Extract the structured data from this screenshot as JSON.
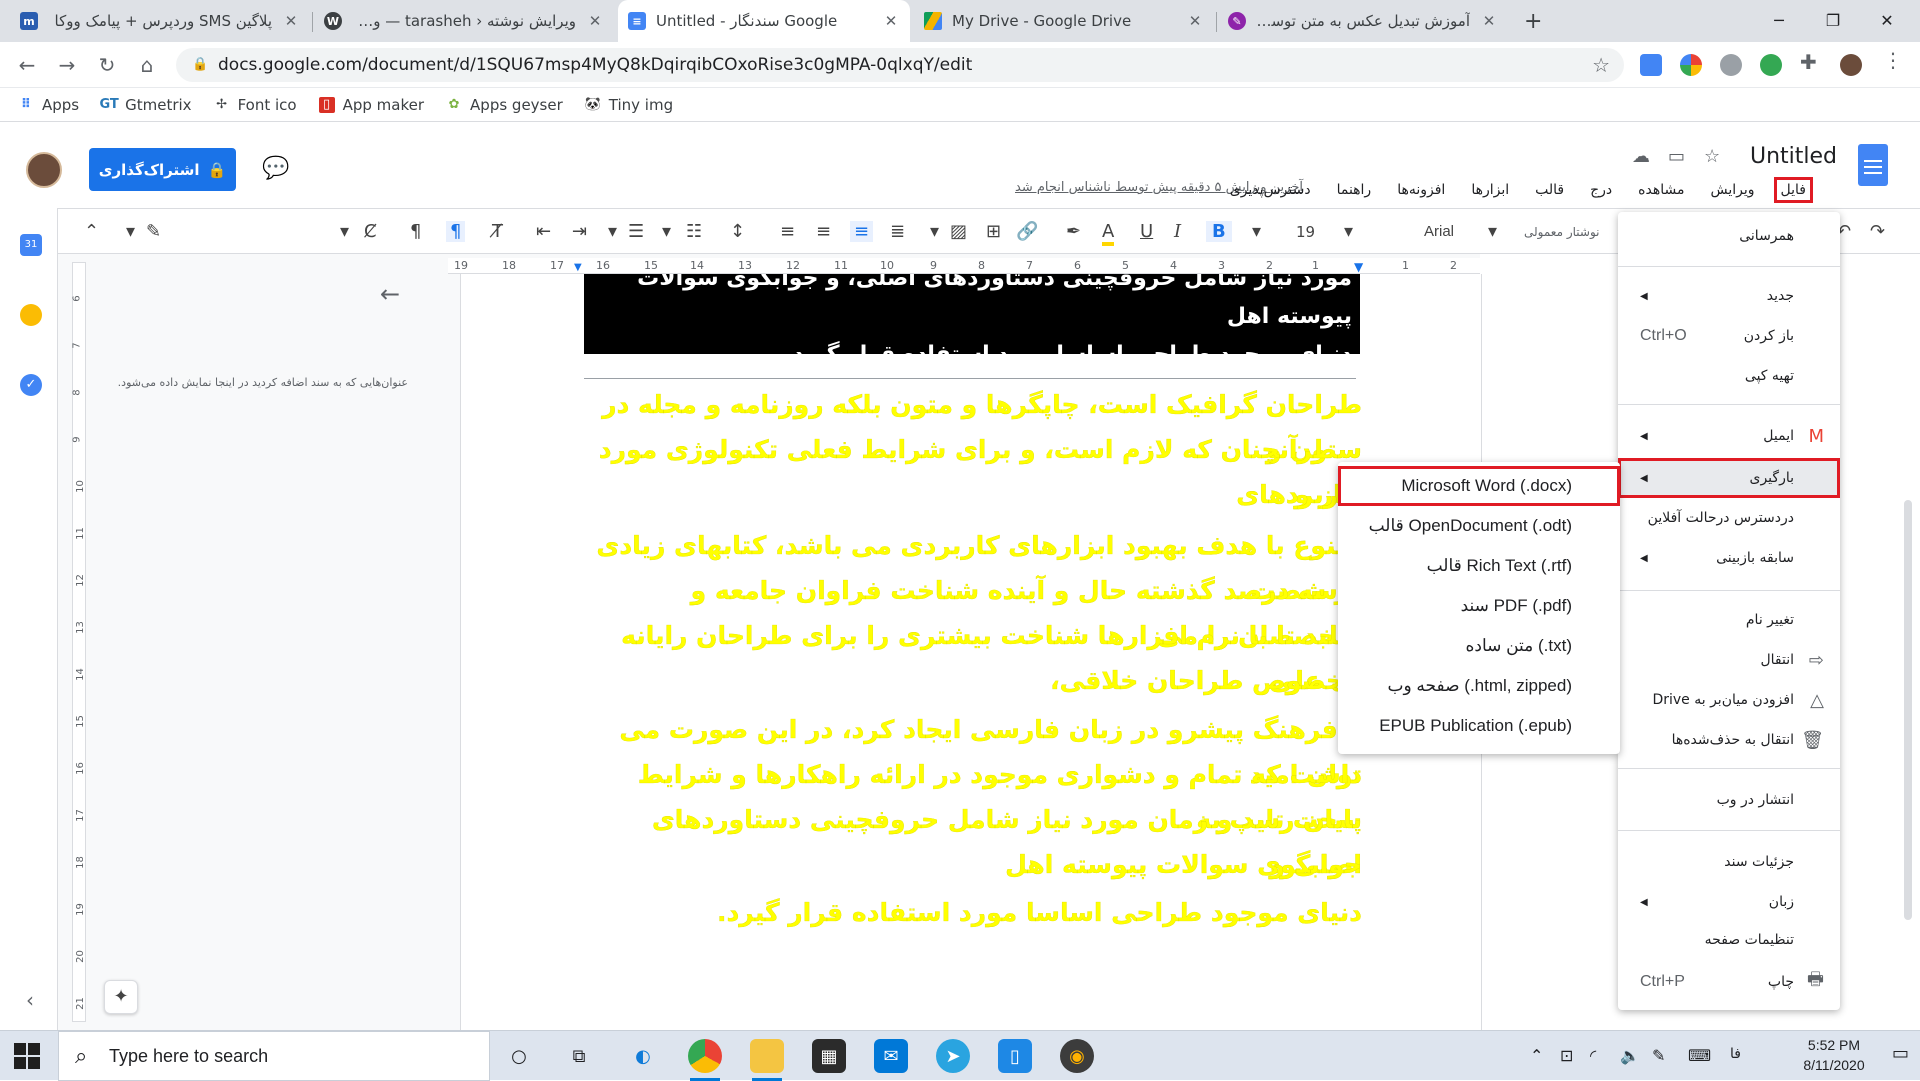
{
  "browser": {
    "tabs": [
      {
        "title": "پلاگین SMS وردپرس + پیامک ووکا",
        "icon": "m-icon",
        "color": "#2a5db0"
      },
      {
        "title": "ویرایش نوشته ‹ tarasheh — وردپر",
        "icon": "wordpress-icon",
        "color": "#3c4043"
      },
      {
        "title": "Untitled - سندنگار Google",
        "icon": "google-docs-icon",
        "color": "#4285f4",
        "active": true
      },
      {
        "title": "My Drive - Google Drive",
        "icon": "google-drive-icon",
        "color": "#0f9d58"
      },
      {
        "title": "آموزش تبدیل عکس به متن توسط گ",
        "icon": "site-icon",
        "color": "#8e24aa"
      }
    ],
    "new_tab": "+",
    "url": "docs.google.com/document/d/1SQU67msp4MyQ8kDqirqibCOxoRise3c0gMPA-0qlxqY/edit",
    "bookmarks": [
      {
        "label": "Apps",
        "icon": "apps-grid-icon"
      },
      {
        "label": "Gtmetrix",
        "icon": "gtmetrix-icon"
      },
      {
        "label": "Font ico",
        "icon": "font-icon"
      },
      {
        "label": "App maker",
        "icon": "app-maker-icon"
      },
      {
        "label": "Apps geyser",
        "icon": "apps-geyser-icon"
      },
      {
        "label": "Tiny img",
        "icon": "tiny-img-icon"
      }
    ]
  },
  "docs": {
    "title": "Untitled",
    "share_label": "اشتراک‌گذاری",
    "menus": [
      "فایل",
      "ویرایش",
      "مشاهده",
      "درج",
      "قالب",
      "ابزارها",
      "افزونه‌ها",
      "راهنما",
      "دسترس‌پذیری"
    ],
    "last_edit": "آخرین ویرایش ۵ دقیقه پیش توسط ناشناس انجام شد",
    "toolbar": {
      "font": "Arial",
      "style": "نوشتار معمولی",
      "size": "19"
    },
    "outline_hint": "عنوان‌هایی که به سند اضافه کردید در اینجا نمایش داده می‌شود.",
    "ruler_h": [
      "19",
      "18",
      "17",
      "16",
      "15",
      "14",
      "13",
      "12",
      "11",
      "10",
      "9",
      "8",
      "7",
      "6",
      "5",
      "4",
      "3",
      "2",
      "1",
      "1",
      "2"
    ],
    "ruler_v": [
      "6",
      "7",
      "8",
      "9",
      "10",
      "11",
      "12",
      "13",
      "14",
      "15",
      "16",
      "17",
      "18",
      "19",
      "20",
      "21"
    ],
    "body": {
      "black_lines": [
        "مورد نیاز شامل حروفچینی دستاوردهای اصلی، و جوابگوی سوالات پیوسته اهل",
        "دنیای موجود طراحی اساسا مورد استفاده قرار گیرد."
      ],
      "yellow_lines": [
        "طراحان گرافیک است، چاپگرها و متون بلکه روزنامه و مجله در ستون و",
        "سطرآنچنان که لازم است، و برای شرایط فعلی تکنولوژی مورد نیاز و",
        "کاربردهای",
        "متنوع با هدف بهبود ابزارهای کاربردی می باشد، کتابهای زیادی در شصت",
        "و سه درصد گذشته حال و آینده شناخت فراوان جامعه و متخصصان را می",
        "طلبد تا با نرم افزارها شناخت بیشتری را برای طراحان رایانه ای علی",
        "الخصوص طراحان خلاقی،",
        "و فرهنگ پیشرو در زبان فارسی ایجاد کرد، در این صورت می توان امید",
        "داشت که تمام و دشواری موجود در ارائه راهکارها و شرایط سخت تایپ به",
        "پایان رسد و زمان مورد نیاز شامل حروفچینی دستاوردهای اصلی و",
        "جوابگوی سوالات پیوسته اهل",
        "دنیای موجود طراحی اساسا مورد استفاده قرار گیرد."
      ]
    }
  },
  "file_menu": {
    "items": [
      {
        "label": "همرسانی"
      },
      {
        "label": "جدید",
        "arrow": true
      },
      {
        "label": "باز کردن",
        "shortcut": "Ctrl+O"
      },
      {
        "label": "تهیه کپی"
      },
      {
        "label": "ایمیل",
        "arrow": true,
        "icon": "gmail-icon"
      },
      {
        "label": "بارگیری",
        "arrow": true,
        "highlighted": true
      },
      {
        "label": "دردسترس درحالت آفلاین"
      },
      {
        "label": "سابقه بازبینی",
        "arrow": true
      },
      {
        "label": "تغییر نام"
      },
      {
        "label": "انتقال",
        "icon": "move-folder-icon"
      },
      {
        "label": "افزودن میان‌بر به Drive",
        "icon": "drive-shortcut-icon"
      },
      {
        "label": "انتقال به حذف‌شده‌ها",
        "icon": "trash-icon"
      },
      {
        "label": "انتشار در وب"
      },
      {
        "label": "جزئیات سند"
      },
      {
        "label": "زبان",
        "arrow": true
      },
      {
        "label": "تنظیمات صفحه"
      },
      {
        "label": "چاپ",
        "shortcut": "Ctrl+P",
        "icon": "print-icon"
      }
    ]
  },
  "download_submenu": {
    "items": [
      {
        "label": "Microsoft Word (.docx)",
        "highlighted": true
      },
      {
        "label": "قالب OpenDocument (.odt)"
      },
      {
        "label": "قالب Rich Text (.rtf)"
      },
      {
        "label": "سند PDF (.pdf)"
      },
      {
        "label": "متن ساده (.txt)"
      },
      {
        "label": "صفحه وب (.html, zipped)"
      },
      {
        "label": "EPUB Publication (.epub)"
      }
    ]
  },
  "taskbar": {
    "search_placeholder": "Type here to search",
    "time": "5:52 PM",
    "date": "8/11/2020",
    "lang": "فا"
  }
}
